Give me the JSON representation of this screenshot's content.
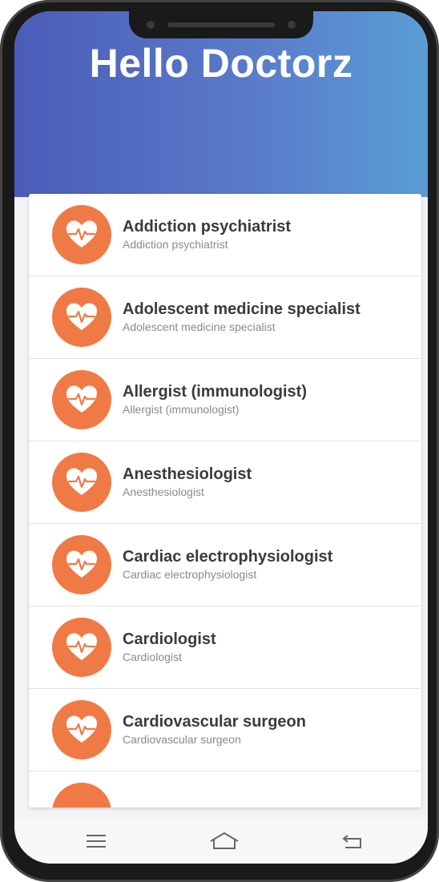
{
  "app": {
    "title": "Hello Doctorz"
  },
  "specialties": [
    {
      "title": "Addiction psychiatrist",
      "subtitle": "Addiction psychiatrist"
    },
    {
      "title": "Adolescent medicine specialist",
      "subtitle": "Adolescent medicine specialist"
    },
    {
      "title": "Allergist (immunologist)",
      "subtitle": "Allergist (immunologist)"
    },
    {
      "title": "Anesthesiologist",
      "subtitle": "Anesthesiologist"
    },
    {
      "title": "Cardiac electrophysiologist",
      "subtitle": "Cardiac electrophysiologist"
    },
    {
      "title": "Cardiologist",
      "subtitle": "Cardiologist"
    },
    {
      "title": "Cardiovascular surgeon",
      "subtitle": "Cardiovascular surgeon"
    }
  ],
  "icons": {
    "list_item": "heart-pulse-icon",
    "nav_menu": "menu-icon",
    "nav_home": "home-icon",
    "nav_back": "back-icon"
  },
  "colors": {
    "header_start": "#4a5cb8",
    "header_end": "#5a9dd6",
    "accent": "#f07a45"
  }
}
